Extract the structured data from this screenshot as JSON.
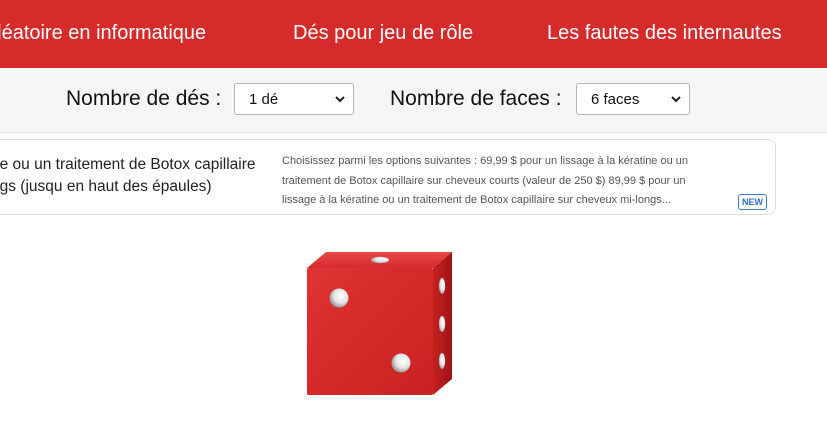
{
  "nav": {
    "items": [
      {
        "label": "aléatoire en informatique"
      },
      {
        "label": "Dés pour jeu de rôle"
      },
      {
        "label": "Les fautes des internautes"
      }
    ]
  },
  "controls": {
    "dice_label": "Nombre de dés :",
    "dice_value": "1 dé",
    "faces_label": "Nombre de faces :",
    "faces_value": "6 faces"
  },
  "ad": {
    "title_lines": [
      "ne ou un traitement de Botox capillaire",
      "ngs (jusqu en haut des épaules)"
    ],
    "description_lines": [
      "Choisissez parmi les options suivantes : 69,99 $ pour un lissage à la kératine ou un",
      "traitement de Botox capillaire sur cheveux courts (valeur de 250 $) 89,99 $ pour un",
      "lissage à la kératine ou un traitement de Botox capillaire sur cheveux mi-longs..."
    ],
    "badge": "NEW"
  },
  "die": {
    "front_value": 2,
    "color": "#d42828",
    "icon": "die-icon"
  },
  "colors": {
    "brand_red": "#d62b2b",
    "badge_blue": "#2f6fd6"
  }
}
